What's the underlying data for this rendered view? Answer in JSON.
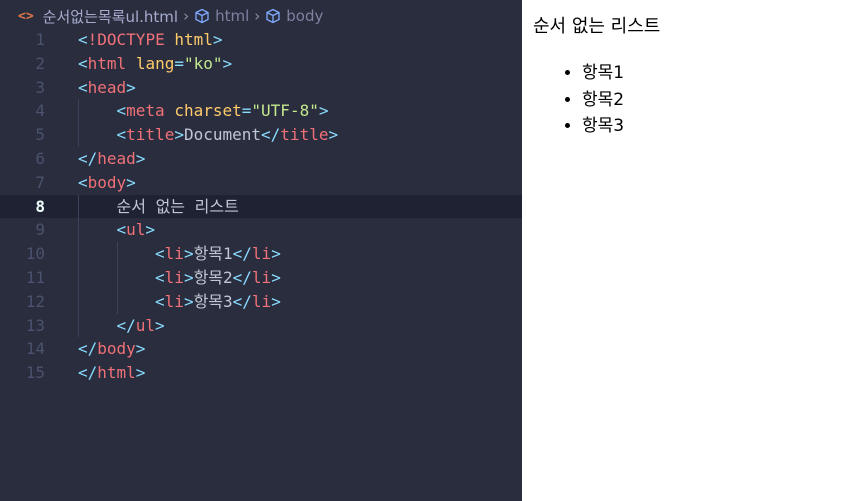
{
  "breadcrumb": {
    "file": "순서없는목록ul.html",
    "items": [
      "html",
      "body"
    ]
  },
  "code_lines": [
    {
      "n": "1",
      "indent": 0,
      "tokens": [
        [
          "br",
          "<"
        ],
        [
          "tag",
          "!DOCTYPE"
        ],
        [
          "txt",
          " "
        ],
        [
          "attr",
          "html"
        ],
        [
          "br",
          ">"
        ]
      ]
    },
    {
      "n": "2",
      "indent": 0,
      "tokens": [
        [
          "br",
          "<"
        ],
        [
          "tag",
          "html"
        ],
        [
          "txt",
          " "
        ],
        [
          "attr",
          "lang"
        ],
        [
          "eq",
          "="
        ],
        [
          "str",
          "\"ko\""
        ],
        [
          "br",
          ">"
        ]
      ]
    },
    {
      "n": "3",
      "indent": 0,
      "tokens": [
        [
          "br",
          "<"
        ],
        [
          "tag",
          "head"
        ],
        [
          "br",
          ">"
        ]
      ]
    },
    {
      "n": "4",
      "indent": 1,
      "tokens": [
        [
          "br",
          "<"
        ],
        [
          "tag",
          "meta"
        ],
        [
          "txt",
          " "
        ],
        [
          "attr",
          "charset"
        ],
        [
          "eq",
          "="
        ],
        [
          "str",
          "\"UTF-8\""
        ],
        [
          "br",
          ">"
        ]
      ]
    },
    {
      "n": "5",
      "indent": 1,
      "tokens": [
        [
          "br",
          "<"
        ],
        [
          "tag",
          "title"
        ],
        [
          "br",
          ">"
        ],
        [
          "txt",
          "Document"
        ],
        [
          "br",
          "</"
        ],
        [
          "tag",
          "title"
        ],
        [
          "br",
          ">"
        ]
      ]
    },
    {
      "n": "6",
      "indent": 0,
      "tokens": [
        [
          "br",
          "</"
        ],
        [
          "tag",
          "head"
        ],
        [
          "br",
          ">"
        ]
      ]
    },
    {
      "n": "7",
      "indent": 0,
      "tokens": [
        [
          "br",
          "<"
        ],
        [
          "tag",
          "body"
        ],
        [
          "br",
          ">"
        ]
      ]
    },
    {
      "n": "8",
      "indent": 1,
      "active": true,
      "tokens": [
        [
          "txt",
          "순서 없는 리스트"
        ]
      ]
    },
    {
      "n": "9",
      "indent": 1,
      "tokens": [
        [
          "br",
          "<"
        ],
        [
          "tag",
          "ul"
        ],
        [
          "br",
          ">"
        ]
      ]
    },
    {
      "n": "10",
      "indent": 2,
      "tokens": [
        [
          "br",
          "<"
        ],
        [
          "tag",
          "li"
        ],
        [
          "br",
          ">"
        ],
        [
          "txt",
          "항목1"
        ],
        [
          "br",
          "</"
        ],
        [
          "tag",
          "li"
        ],
        [
          "br",
          ">"
        ]
      ]
    },
    {
      "n": "11",
      "indent": 2,
      "tokens": [
        [
          "br",
          "<"
        ],
        [
          "tag",
          "li"
        ],
        [
          "br",
          ">"
        ],
        [
          "txt",
          "항목2"
        ],
        [
          "br",
          "</"
        ],
        [
          "tag",
          "li"
        ],
        [
          "br",
          ">"
        ]
      ]
    },
    {
      "n": "12",
      "indent": 2,
      "tokens": [
        [
          "br",
          "<"
        ],
        [
          "tag",
          "li"
        ],
        [
          "br",
          ">"
        ],
        [
          "txt",
          "항목3"
        ],
        [
          "br",
          "</"
        ],
        [
          "tag",
          "li"
        ],
        [
          "br",
          ">"
        ]
      ]
    },
    {
      "n": "13",
      "indent": 1,
      "tokens": [
        [
          "br",
          "</"
        ],
        [
          "tag",
          "ul"
        ],
        [
          "br",
          ">"
        ]
      ]
    },
    {
      "n": "14",
      "indent": 0,
      "tokens": [
        [
          "br",
          "</"
        ],
        [
          "tag",
          "body"
        ],
        [
          "br",
          ">"
        ]
      ]
    },
    {
      "n": "15",
      "indent": 0,
      "tokens": [
        [
          "br",
          "</"
        ],
        [
          "tag",
          "html"
        ],
        [
          "br",
          ">"
        ]
      ]
    }
  ],
  "preview": {
    "heading": "순서 없는 리스트",
    "items": [
      "항목1",
      "항목2",
      "항목3"
    ]
  },
  "colors": {
    "editor_bg": "#292d3e",
    "tag": "#f07178",
    "bracket": "#89ddff",
    "attr": "#ffcb6b",
    "string": "#c3e88d",
    "text": "#bfc7d5",
    "line_number": "#4b526d"
  }
}
